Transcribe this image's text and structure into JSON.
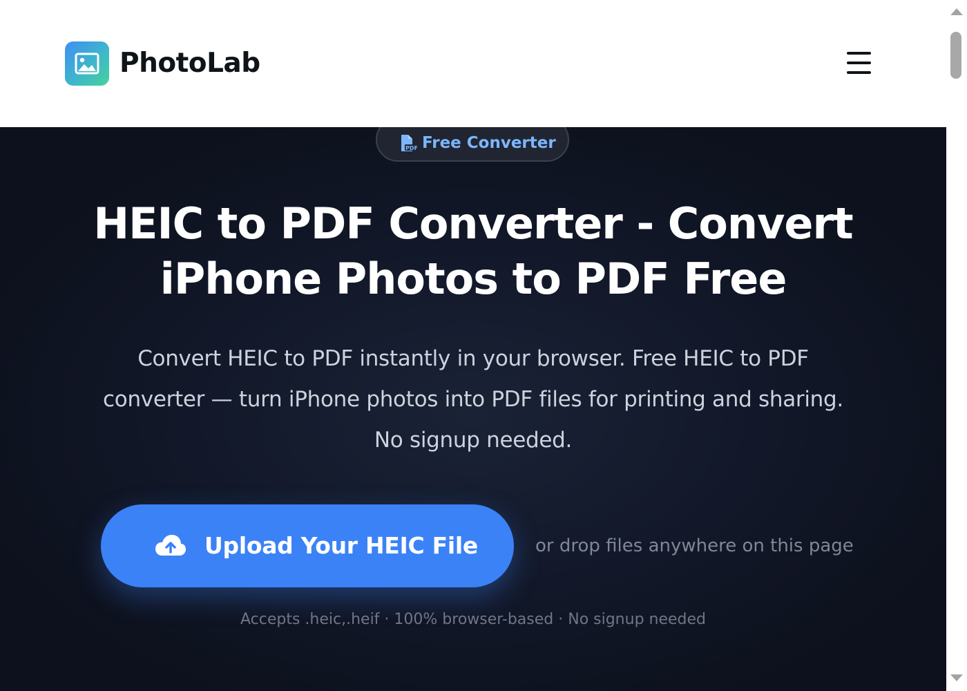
{
  "brand": {
    "name": "PhotoLab",
    "logo_icon": "image-icon",
    "logo_gradient": [
      "#3f8ff2",
      "#45d39a"
    ]
  },
  "header": {
    "menu_icon": "hamburger-menu-icon"
  },
  "hero": {
    "badge": {
      "icon": "pdf-file-icon",
      "label": "Free Converter"
    },
    "title_line1": "HEIC to PDF Converter - Convert",
    "title_line2": "iPhone Photos to PDF Free",
    "subtitle_line1": "Convert HEIC to PDF instantly in your browser. Free HEIC to PDF",
    "subtitle_line2": "converter — turn iPhone photos into PDF files for printing and sharing.",
    "subtitle_line3": "No signup needed.",
    "upload_button": {
      "icon": "cloud-upload-icon",
      "label": "Upload Your HEIC File"
    },
    "drop_hint": "or drop files anywhere on this page",
    "accepts": "Accepts .heic,.heif · 100% browser-based · No signup needed"
  },
  "colors": {
    "accent": "#3b82f6",
    "badge_text": "#7cb6ff",
    "hero_background": "#121829",
    "header_background": "#ffffff"
  }
}
